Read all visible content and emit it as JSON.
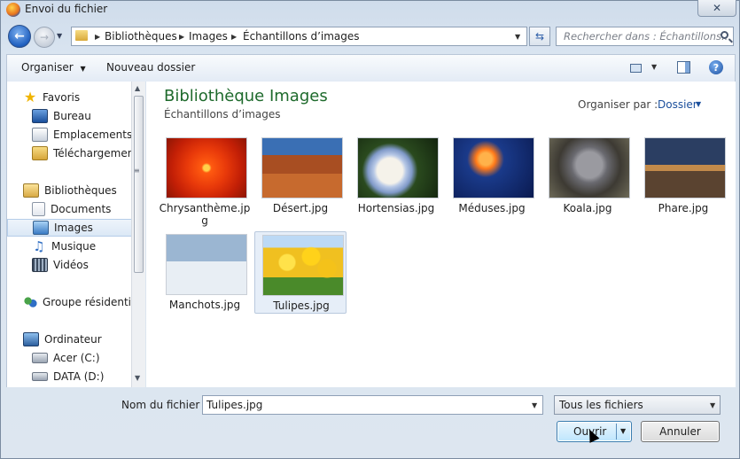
{
  "window": {
    "title": "Envoi du fichier",
    "close_label": "✕"
  },
  "nav": {
    "back_icon": "back-arrow-icon",
    "forward_icon": "forward-arrow-icon",
    "breadcrumb": [
      "Bibliothèques",
      "Images",
      "Échantillons d’images"
    ],
    "search_placeholder": "Rechercher dans : Échantillons..."
  },
  "toolbar": {
    "organize_label": "Organiser",
    "new_folder_label": "Nouveau dossier"
  },
  "sidebar": {
    "favorites": {
      "label": "Favoris",
      "items": [
        "Bureau",
        "Emplacements récents",
        "Téléchargements"
      ]
    },
    "libraries": {
      "label": "Bibliothèques",
      "items": [
        "Documents",
        "Images",
        "Musique",
        "Vidéos"
      ],
      "selected": "Images"
    },
    "homegroup": {
      "label": "Groupe résidentiel"
    },
    "computer": {
      "label": "Ordinateur",
      "items": [
        "Acer (C:)",
        "DATA (D:)"
      ]
    }
  },
  "content": {
    "title": "Bibliothèque Images",
    "subtitle": "Échantillons d’images",
    "arrange_label": "Organiser par :",
    "arrange_value": "Dossier",
    "files": [
      {
        "name": "Chrysanthème.jpg"
      },
      {
        "name": "Désert.jpg"
      },
      {
        "name": "Hortensias.jpg"
      },
      {
        "name": "Méduses.jpg"
      },
      {
        "name": "Koala.jpg"
      },
      {
        "name": "Phare.jpg"
      },
      {
        "name": "Manchots.jpg"
      },
      {
        "name": "Tulipes.jpg"
      }
    ],
    "selected_file": "Tulipes.jpg"
  },
  "footer": {
    "filename_label": "Nom du fichier :",
    "filename_value": "Tulipes.jpg",
    "filter_value": "Tous les fichiers",
    "open_label": "Ouvrir",
    "cancel_label": "Annuler"
  }
}
